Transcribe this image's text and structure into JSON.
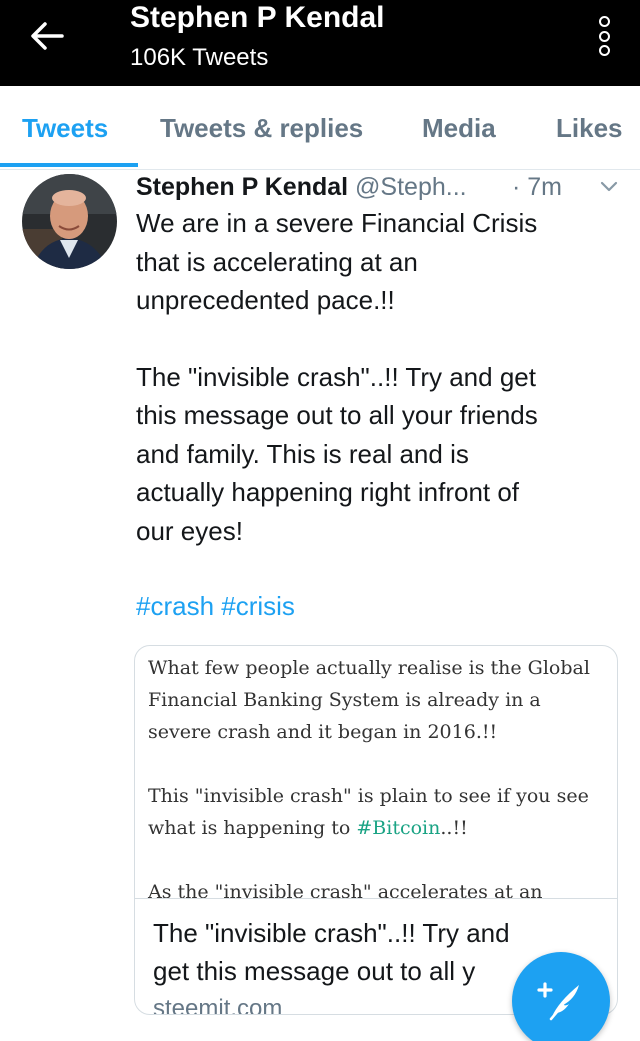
{
  "header": {
    "title": "Stephen P Kendal",
    "subtitle": "106K Tweets",
    "back_icon": "arrow-left-icon",
    "more_icon": "more-vertical-icon"
  },
  "tabs": [
    {
      "label": "Tweets",
      "active": true
    },
    {
      "label": "Tweets & replies",
      "active": false
    },
    {
      "label": "Media",
      "active": false
    },
    {
      "label": "Likes",
      "active": false
    }
  ],
  "tweet": {
    "author": "Stephen P Kendal",
    "handle": "@Steph...",
    "time": "· 7m",
    "caret_icon": "chevron-down-icon",
    "lines": [
      "We are in a severe Financial Crisis",
      "that is accelerating at an",
      "unprecedented pace.!!",
      "The \"invisible crash\"..!! Try and get",
      "this message out to all your friends",
      "and family. This is real and is",
      "actually happening right infront of",
      "our eyes!"
    ],
    "hashtags": "#crash #crisis",
    "card": {
      "preview_lines": [
        "What few people actually realise is the Global",
        "Financial Banking System is already in a",
        "severe crash and it began in 2016.!!",
        "This \"invisible crash\" is plain to see if you see",
        "what is happening to ",
        "#Bitcoin",
        "..!!",
        "As the \"invisible crash\" accelerates at an"
      ],
      "title_line1": "The \"invisible crash\"..!! Try and",
      "title_line2": "get this message out to all y",
      "domain": "steemit.com"
    }
  },
  "fab": {
    "icon": "compose-tweet-icon"
  },
  "colors": {
    "accent": "#1da1f2",
    "header_bg": "#000000",
    "secondary_text": "#657786",
    "steemit_tag": "#1aa384"
  }
}
